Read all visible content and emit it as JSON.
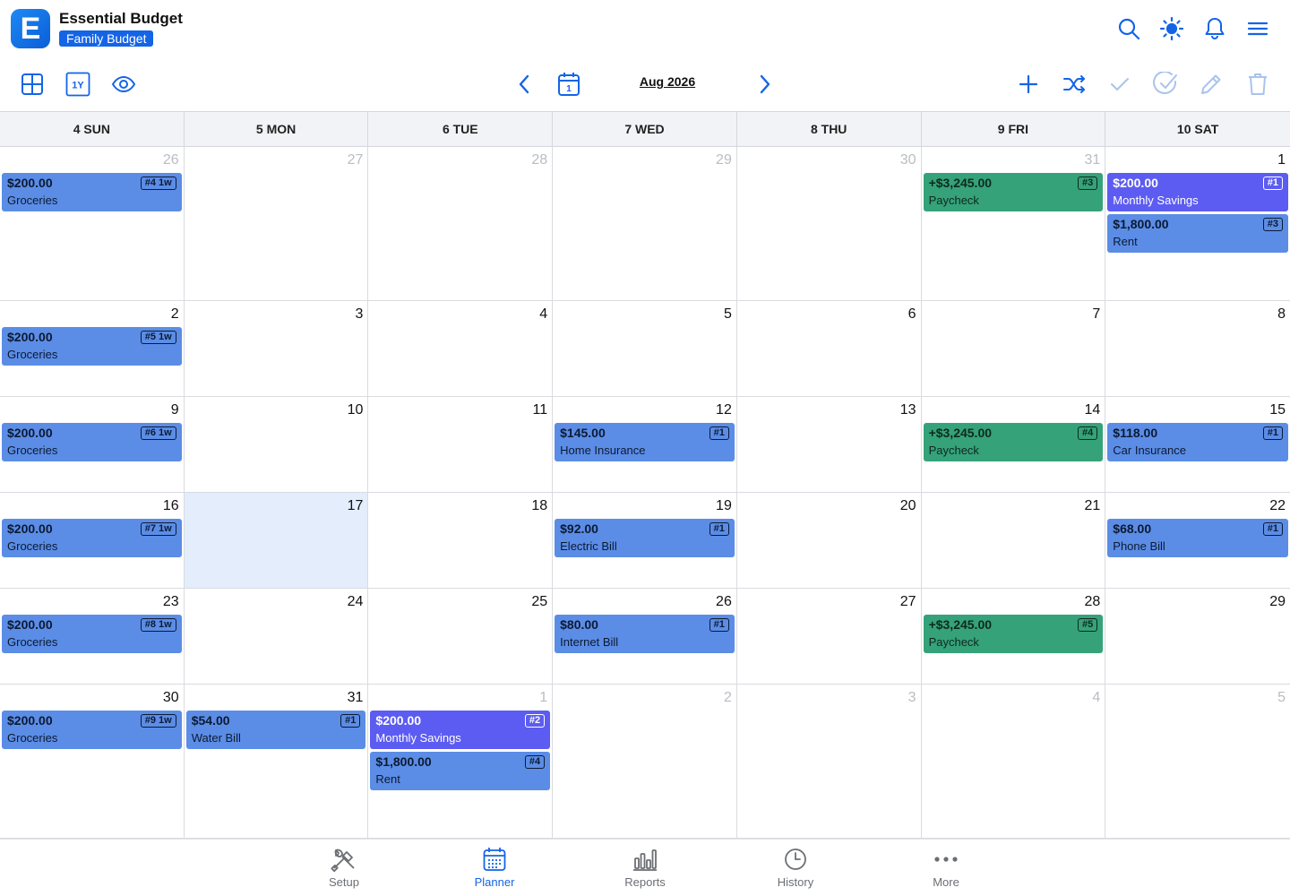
{
  "app": {
    "logo_letter": "E",
    "title": "Essential Budget",
    "budget_name": "Family Budget"
  },
  "header_icons": [
    "search-icon",
    "brightness-icon",
    "bell-icon",
    "menu-icon"
  ],
  "toolbar": {
    "month_label": "Aug 2026",
    "year_toggle": "1Y",
    "left_icons": [
      "grid-icon",
      "year-view-icon",
      "eye-icon"
    ],
    "right_icons": [
      "add-icon",
      "shuffle-icon",
      "check-icon",
      "check-circle-icon",
      "edit-icon",
      "trash-icon"
    ]
  },
  "calendar": {
    "weekdays": [
      "4 SUN",
      "5 MON",
      "6 TUE",
      "7 WED",
      "8 THU",
      "9 FRI",
      "10 SAT"
    ],
    "weeks": [
      {
        "days": [
          {
            "num": "26",
            "other": true,
            "events": [
              {
                "amount": "$200.00",
                "name": "Groceries",
                "tag": "#4 1w",
                "color": "blue"
              }
            ]
          },
          {
            "num": "27",
            "other": true,
            "events": []
          },
          {
            "num": "28",
            "other": true,
            "events": []
          },
          {
            "num": "29",
            "other": true,
            "events": []
          },
          {
            "num": "30",
            "other": true,
            "events": []
          },
          {
            "num": "31",
            "other": true,
            "events": [
              {
                "amount": "+$3,245.00",
                "name": "Paycheck",
                "tag": "#3",
                "color": "green"
              }
            ]
          },
          {
            "num": "1",
            "other": false,
            "events": [
              {
                "amount": "$200.00",
                "name": "Monthly Savings",
                "tag": "#1",
                "color": "purple"
              },
              {
                "amount": "$1,800.00",
                "name": "Rent",
                "tag": "#3",
                "color": "blue"
              }
            ]
          }
        ]
      },
      {
        "days": [
          {
            "num": "2",
            "events": [
              {
                "amount": "$200.00",
                "name": "Groceries",
                "tag": "#5 1w",
                "color": "blue"
              }
            ]
          },
          {
            "num": "3",
            "events": []
          },
          {
            "num": "4",
            "events": []
          },
          {
            "num": "5",
            "events": []
          },
          {
            "num": "6",
            "events": []
          },
          {
            "num": "7",
            "events": []
          },
          {
            "num": "8",
            "events": []
          }
        ]
      },
      {
        "days": [
          {
            "num": "9",
            "events": [
              {
                "amount": "$200.00",
                "name": "Groceries",
                "tag": "#6 1w",
                "color": "blue"
              }
            ]
          },
          {
            "num": "10",
            "events": []
          },
          {
            "num": "11",
            "events": []
          },
          {
            "num": "12",
            "events": [
              {
                "amount": "$145.00",
                "name": "Home Insurance",
                "tag": "#1",
                "color": "blue"
              }
            ]
          },
          {
            "num": "13",
            "events": []
          },
          {
            "num": "14",
            "events": [
              {
                "amount": "+$3,245.00",
                "name": "Paycheck",
                "tag": "#4",
                "color": "green"
              }
            ]
          },
          {
            "num": "15",
            "events": [
              {
                "amount": "$118.00",
                "name": "Car Insurance",
                "tag": "#1",
                "color": "blue"
              }
            ]
          }
        ]
      },
      {
        "days": [
          {
            "num": "16",
            "events": [
              {
                "amount": "$200.00",
                "name": "Groceries",
                "tag": "#7 1w",
                "color": "blue"
              }
            ]
          },
          {
            "num": "17",
            "today": true,
            "events": []
          },
          {
            "num": "18",
            "events": []
          },
          {
            "num": "19",
            "events": [
              {
                "amount": "$92.00",
                "name": "Electric Bill",
                "tag": "#1",
                "color": "blue"
              }
            ]
          },
          {
            "num": "20",
            "events": []
          },
          {
            "num": "21",
            "events": []
          },
          {
            "num": "22",
            "events": [
              {
                "amount": "$68.00",
                "name": "Phone Bill",
                "tag": "#1",
                "color": "blue"
              }
            ]
          }
        ]
      },
      {
        "days": [
          {
            "num": "23",
            "events": [
              {
                "amount": "$200.00",
                "name": "Groceries",
                "tag": "#8 1w",
                "color": "blue"
              }
            ]
          },
          {
            "num": "24",
            "events": []
          },
          {
            "num": "25",
            "events": []
          },
          {
            "num": "26",
            "events": [
              {
                "amount": "$80.00",
                "name": "Internet Bill",
                "tag": "#1",
                "color": "blue"
              }
            ]
          },
          {
            "num": "27",
            "events": []
          },
          {
            "num": "28",
            "events": [
              {
                "amount": "+$3,245.00",
                "name": "Paycheck",
                "tag": "#5",
                "color": "green"
              }
            ]
          },
          {
            "num": "29",
            "events": []
          }
        ]
      },
      {
        "days": [
          {
            "num": "30",
            "events": [
              {
                "amount": "$200.00",
                "name": "Groceries",
                "tag": "#9 1w",
                "color": "blue"
              }
            ]
          },
          {
            "num": "31",
            "events": [
              {
                "amount": "$54.00",
                "name": "Water Bill",
                "tag": "#1",
                "color": "blue"
              }
            ]
          },
          {
            "num": "1",
            "other": true,
            "events": [
              {
                "amount": "$200.00",
                "name": "Monthly Savings",
                "tag": "#2",
                "color": "purple"
              },
              {
                "amount": "$1,800.00",
                "name": "Rent",
                "tag": "#4",
                "color": "blue"
              }
            ]
          },
          {
            "num": "2",
            "other": true,
            "events": []
          },
          {
            "num": "3",
            "other": true,
            "events": []
          },
          {
            "num": "4",
            "other": true,
            "events": []
          },
          {
            "num": "5",
            "other": true,
            "events": []
          }
        ]
      }
    ]
  },
  "bottom_nav": [
    {
      "label": "Setup",
      "icon": "tools-icon",
      "active": false
    },
    {
      "label": "Planner",
      "icon": "calendar-grid-icon",
      "active": true
    },
    {
      "label": "Reports",
      "icon": "bar-chart-icon",
      "active": false
    },
    {
      "label": "History",
      "icon": "clock-icon",
      "active": false
    },
    {
      "label": "More",
      "icon": "more-dots-icon",
      "active": false
    }
  ],
  "colors": {
    "accent": "#1464e6",
    "event_blue": "#5b8de6",
    "event_green": "#35a27a",
    "event_purple": "#5c5cf2",
    "today": "#e3edfb"
  }
}
